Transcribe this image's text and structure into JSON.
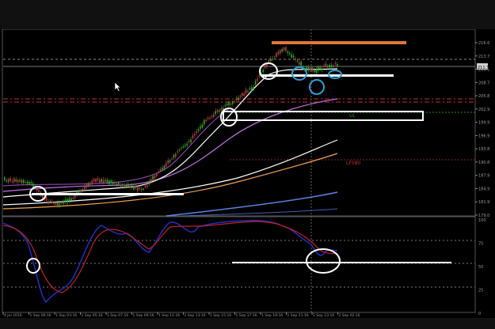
{
  "window": {
    "title": ""
  },
  "price_axis": {
    "labels": [
      "216.6",
      "213.7",
      "211.1",
      "208.7",
      "205.8",
      "202.9",
      "199.9",
      "196.9",
      "193.8",
      "190.8",
      "187.9",
      "184.9",
      "181.9",
      "179.0"
    ],
    "current_price": "211.3",
    "current_price_color": "#d0d0d0"
  },
  "oscillator_axis": {
    "labels": [
      "100",
      "75",
      "50",
      "25",
      "0"
    ]
  },
  "time_axis": {
    "labels": [
      "4 Jul 2016",
      "1 Sep 06:16",
      "1 Sep 03:16",
      "1 Sep 05:16",
      "1 Sep 07:16",
      "1 Sep 09:16",
      "1 Sep 11:16",
      "1 Sep 13:16",
      "1 Sep 15:16",
      "1 Sep 17:16",
      "1 Sep 19:16",
      "1 Sep 21:16",
      "1 Sep 23:16",
      "2 Sep 02:16"
    ]
  },
  "annotations": {
    "line_label_green": "UL",
    "line_label_red": "LF580"
  },
  "colors": {
    "background": "#000000",
    "bull_candle": "#2eaa2e",
    "bear_candle": "#b34040",
    "annotation_orange": "#e0763a",
    "annotation_white": "#ffffff",
    "annotation_blue": "#2a9fd6",
    "ma_white": "#ffffff",
    "ma_violet": "#c070e0",
    "ma_orange": "#f0a050",
    "ma_blue": "#6080e0",
    "osc_blue": "#2030c0",
    "osc_red": "#c02020",
    "level_red": "#c03030",
    "level_green": "#2a8a2a"
  },
  "icons": [
    "mouse-pointer-icon"
  ]
}
